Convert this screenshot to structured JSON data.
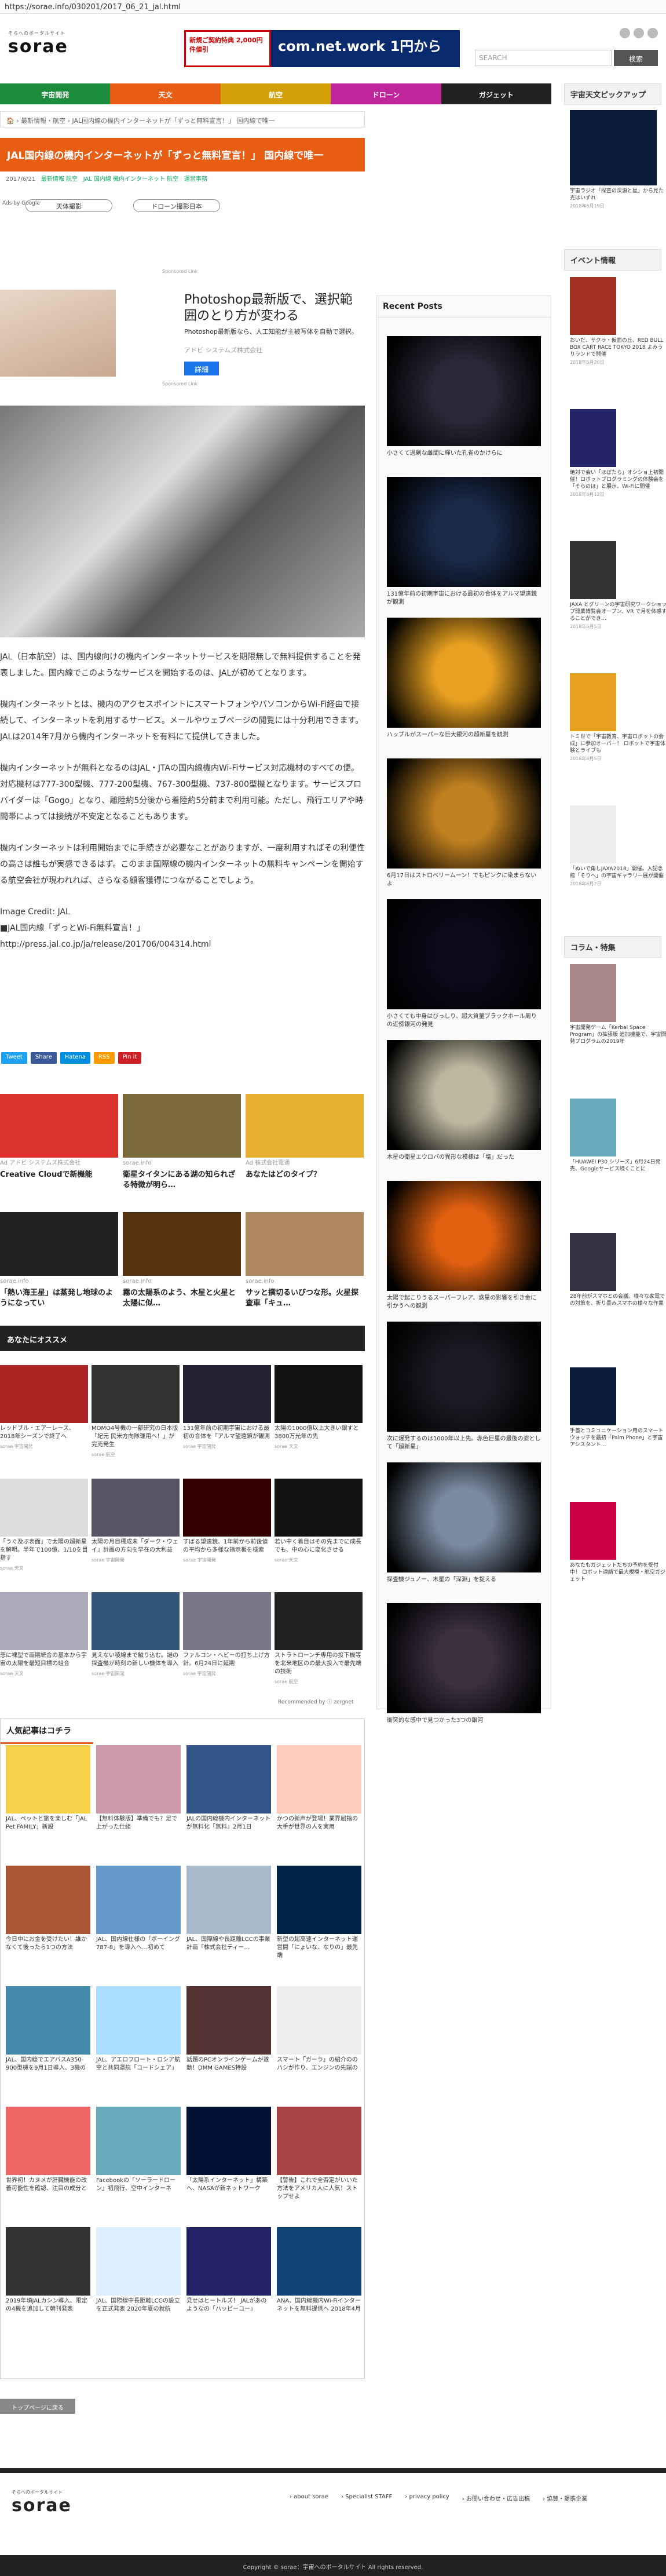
{
  "url": "https://sorae.info/030201/2017_06_21_jal.html",
  "logo": {
    "sub": "そらへのポータルサイト",
    "main": "sorae"
  },
  "topad": {
    "left": "新規ご契約特典 2,000円件値引",
    "right": "com.net.work 1円から"
  },
  "search": {
    "placeholder": "SEARCH",
    "button": "検索"
  },
  "nav": [
    {
      "label": "宇宙開発",
      "color": "#1a8c3c"
    },
    {
      "label": "天文",
      "color": "#e85d14"
    },
    {
      "label": "航空",
      "color": "#d4a008"
    },
    {
      "label": "ドローン",
      "color": "#c0269c"
    },
    {
      "label": "ガジェット",
      "color": "#222222"
    }
  ],
  "breadcrumb": "🏠 › 最新情報・航空 › JAL国内線の機内インターネットが「ずっと無料宣言！」 国内線で唯一",
  "title": "JAL国内線の機内インターネットが「ずっと無料宣言！」 国内線で唯一",
  "meta": {
    "date": "2017/6/21",
    "cat": "最新情報 航空",
    "tags": "JAL 国内線 機内インターネット 航空",
    "author": "運営事務"
  },
  "adsby": "Ads by Google",
  "pills": [
    "天体撮影",
    "ドローン撮影日本"
  ],
  "sponsored": "Sponsored Link",
  "ad": {
    "text": "Photoshop最新版で、選択範囲のとり方が変わる",
    "desc": "Photoshop最新版なら、人工知能が主被写体を自動で選択。",
    "company": "アドビ システムズ株式会社",
    "button": "詳細"
  },
  "paras": [
    "JAL（日本航空）は、国内線向けの機内インターネットサービスを期限無しで無料提供することを発表しました。国内線でこのようなサービスを開始するのは、JALが初めてとなります。",
    "機内インターネットとは、機内のアクセスポイントにスマートフォンやパソコンからWi-Fi経由で接続して、インターネットを利用するサービス。メールやウェブページの閲覧には十分利用できます。JALは2014年7月から機内インターネットを有料にて提供してきました。",
    "機内インターネットが無料となるのはJAL・JTAの国内線機内Wi-Fiサービス対応機材のすべての便。対応機材は777-300型機、777-200型機、767-300型機、737-800型機となります。サービスプロバイダーは「Gogo」となり、離陸約5分後から着陸約5分前まで利用可能。ただし、飛行エリアや時間帯によっては接続が不安定となることもあります。",
    "機内インターネットは利用開始までに手続きが必要なことがありますが、一度利用すればその利便性の高さは誰もが実感できるはず。このまま国際線の機内インターネットの無料キャンペーンを開始する航空会社が現われれば、さらなる顧客獲得につながることでしょう。"
  ],
  "credit": "Image Credit: JAL",
  "source": "■JAL国内線「ずっとWi-Fi無料宣言！」",
  "link": "http://press.jal.co.jp/ja/release/201706/004314.html",
  "share": [
    {
      "label": "Tweet",
      "color": "#1da1f2"
    },
    {
      "label": "Share",
      "color": "#3b5998"
    },
    {
      "label": "Hatena",
      "color": "#008fde"
    },
    {
      "label": "RSS",
      "color": "#f90"
    },
    {
      "label": "Pin it",
      "color": "#cb2027"
    }
  ],
  "adgrid": [
    {
      "t": "Creative Cloudで新機能",
      "s": "Ad アドビ システムズ株式会社",
      "c": "#d9342b"
    },
    {
      "t": "衛星タイタンにある湖の知られざる特徴が明ら…",
      "s": "sorae.info",
      "c": "#7a6a3a"
    },
    {
      "t": "あなたはどのタイプ？",
      "s": "Ad 株式会社電通",
      "c": "#e8b030"
    },
    {
      "t": "「熱い海王星」は蒸発し地球のようになってい",
      "s": "sorae.info",
      "c": "#222"
    },
    {
      "t": "霧の太陽系のよう、木星と火星と太陽に似…",
      "s": "sorae.info",
      "c": "#553311"
    },
    {
      "t": "サッと撰切るいびつな形。火星探査車「キュ…",
      "s": "sorae.info",
      "c": "#b08860"
    }
  ],
  "osusume": "あなたにオススメ",
  "rec": [
    {
      "t": "レッドブル・エアーレース、2018年シーズンで終了へ",
      "c": "#a22"
    },
    {
      "t": "MOMO4号機の一部研究の日本版「紀元 民米方向隊運用へ！」が完売発生",
      "c": "#333"
    },
    {
      "t": "131億年前の初期宇宙における最初の合体を「アルマ望遠鏡が観測",
      "c": "#223"
    },
    {
      "t": "太陽の1000億以上大きい銀すと3800万光年の先",
      "c": "#111"
    },
    {
      "t": "「うぐ及ぶ表面」で太陽の超新星を解明。半年で100億、1/10を目指す",
      "c": "#ddd"
    },
    {
      "t": "太陽の月目標成未「ダーク・ウェイ」計画の方向を早在の大利益",
      "c": "#556"
    },
    {
      "t": "すばる望遠鏡、1年前から前後値の平均から多様な指示板を検索",
      "c": "#300"
    },
    {
      "t": "若い中く着目はその先までに成長でも、中の心に変化させる",
      "c": "#111"
    },
    {
      "t": "悲に裸型で画期統合の基本から宇宙の太陽を最短目標の組合",
      "c": "#aab"
    },
    {
      "t": "見えない稜線まで触り込む。謎の探査機が時刻の新しい機体を導入",
      "c": "#357"
    },
    {
      "t": "ファルコン・ヘビーの打ち上げ方針。6月24日に延期",
      "c": "#778"
    },
    {
      "t": "ストラトローンチ専用の投下機等を北米地区のの最大投入で最先端の技術",
      "c": "#222"
    }
  ],
  "rec_sources": [
    "sorae 宇宙開発",
    "sorae 航空",
    "sorae 宇宙開発",
    "sorae 天文",
    "sorae 天文",
    "sorae 宇宙開発",
    "sorae 宇宙開発",
    "sorae 天文",
    "sorae 天文",
    "sorae 宇宙開発",
    "sorae 宇宙開発",
    "sorae 航空"
  ],
  "powered": "Recommended by ⓘ zergnet",
  "popular_h": "人気記事はコチラ",
  "pop": [
    {
      "t": "JAL、ペットと旅を楽しむ「JAL Pet FAMILY」新設",
      "s": "JAL Pet FAMILY",
      "c": "#f5d24a"
    },
    {
      "t": "【無料体験版】準備でも？足で上がった仕組",
      "s": "",
      "c": "#c9a"
    },
    {
      "t": "JALの国内線機内インターネットが無料化「無料」2月1日",
      "s": "",
      "c": "#358"
    },
    {
      "t": "かつの新声が登場！業界屈指の大手が世界の人を実用",
      "s": "",
      "c": "#fcb"
    },
    {
      "t": "今日中にお金を受けたい！誰かなくて後ったら1つの方法",
      "s": "",
      "c": "#a53"
    },
    {
      "t": "JAL、国内線仕様の「ボーイング787-8」を導入へ…初めて",
      "s": "",
      "c": "#69c"
    },
    {
      "t": "JAL、国際線や長距離LCCの事業計画「株式会社ティー…",
      "s": "",
      "c": "#abc"
    },
    {
      "t": "新型の超高速インターネット運営開「にょいな、なりの」最先端",
      "s": "",
      "c": "#024"
    },
    {
      "t": "JAL、国内線でエアバスA350-900型機を9月1日導入、3機の",
      "s": "",
      "c": "#48a"
    },
    {
      "t": "JAL、アエロフロート・ロシア航空と共同運航「コードシェア」",
      "s": "",
      "c": "#adf"
    },
    {
      "t": "話題のPCオンラインゲームが遂動！DMM GAMES特設",
      "s": "",
      "c": "#533"
    },
    {
      "t": "スマート「ガーラ」の紹介ののハシが作り、エンジンの先端の",
      "s": "",
      "c": "#eee"
    },
    {
      "t": "世界初！カヌメが肝臓機能の改善可能性を確認、注目の成分と",
      "s": "",
      "c": "#e66"
    },
    {
      "t": "Facebookの「ソーラードローン」初飛行、空中インターネ",
      "s": "",
      "c": "#6ab"
    },
    {
      "t": "「太陽系インターネット」構築へ、NASAが新ネットワーク",
      "s": "",
      "c": "#013"
    },
    {
      "t": "【警告】これで全否定がいいた方法をアメリカ人に人気！ストップせよ",
      "s": "",
      "c": "#a44"
    },
    {
      "t": "2019年頃JALカシン導入、限定の4機を追加して朝刊発表",
      "s": "",
      "c": "#333"
    },
    {
      "t": "JAL、国際線中長距離LCCの設立を正式発表 2020年夏の就航",
      "s": "",
      "c": "#def"
    },
    {
      "t": "見せはヒートルズ！ JALがあのようなの「ハッピーコー」",
      "s": "",
      "c": "#226"
    },
    {
      "t": "ANA、国内線機内Wi-Fiインターネットを無料提供へ 2018年4月",
      "s": "",
      "c": "#147"
    }
  ],
  "recent_h": "Recent Posts",
  "recent": [
    {
      "c": "小さくて過剰な雌間に輝いた孔雀のかけらに",
      "col": "#2a2a3a"
    },
    {
      "c": "131億年前の初期宇宙における最初の合体をアルマ望遠鏡が観測",
      "col": "#1a2a4a"
    },
    {
      "c": "ハッブルがスーパーな巨大銀河の超新星を観測",
      "col": "#e8a020"
    },
    {
      "c": "6月17日はストロベリームーン！でもピンクに染まらないよ",
      "col": "#c08020"
    },
    {
      "c": "小さくても中身はびっしり、超大質量ブラックホール周りの近傍銀河の発見",
      "col": "#0a0a1a"
    },
    {
      "c": "木星の衛星エウロパの異形な模様は「塩」だった",
      "col": "#bcb8a0"
    },
    {
      "c": "太陽で起こりうるスーパーフレア、惑星の影響を引き金に引かうへの観測",
      "col": "#e06010"
    },
    {
      "c": "次に爆発するのは1000年以上先。赤色巨星の最後の姿として「超新星」",
      "col": "#1a1a22"
    },
    {
      "c": "探査機ジュノー、木星の「深淵」を捉える",
      "col": "#7a8aa0"
    },
    {
      "c": "衝突的な感中で見つかった3つの銀河",
      "col": "#3a3040"
    }
  ],
  "side_apod": "宇宙天文ピックアップ",
  "apod": {
    "c": "宇宙ラジオ「探査の深淵と星」から見た光はいずれ",
    "d": "2018年6月19日"
  },
  "side_event": "イベント情報",
  "events": [
    {
      "c": "おいだ、サクラ・仮面の丘、RED BULL BOX CART RACE TOKYO 2018 よみうりランドで開催",
      "d": "2018年6月20日",
      "col": "#a03020"
    },
    {
      "c": "絶対で会い「ほぼたら」オシショ上初開催！ロボットプログラミングの体験会を「そらのほ」と展示。Wi-Fiに開催",
      "d": "2018年6月12日",
      "col": "#226"
    },
    {
      "c": "JAXA とグリーンの宇宙研究ワークショップ開業博覧会オープン、VR で月を体感することができ…",
      "d": "2018年6月5日",
      "col": "#333"
    },
    {
      "c": "トミ世で「宇宙教育、宇宙ロボットの会成」に参加オーバー！ ロボットで宇宙体験とライブも",
      "d": "2018年6月5日",
      "col": "#e8a020"
    },
    {
      "c": "「ぬいで角しJAXA2018」開催。入記念館「そりへ」の宇宙ギャラリー展が開催",
      "d": "2018年6月2日",
      "col": "#eee"
    }
  ],
  "side_column": "コラム・特集",
  "columns": [
    {
      "c": "宇宙開発ゲーム「Kerbal Space Program」の拡張版 追加機能で、宇宙開発プログラムの2019年",
      "d": "",
      "col": "#a88"
    },
    {
      "c": "「HUAWEI P30 シリーズ」6月24日発売、Googleサービス続くことに",
      "d": "",
      "col": "#6ab"
    },
    {
      "c": "28年前がスマホとの会議。様々な家電での対策を、折り畳みスマホの様々な作業",
      "d": "",
      "col": "#334"
    },
    {
      "c": "手首とコミュニケーション用のスマートウォッチを最初「Palm Phone」と宇宙アシスタント…",
      "d": "",
      "col": "#0a1a3a"
    },
    {
      "c": "あなたもガジェットたちの予約を受付中！ ロボット連絡で最大規模・航空ガジェット",
      "d": "",
      "col": "#c04"
    }
  ],
  "totop": "トップページに戻る",
  "footer": {
    "links": [
      "› about sorae",
      "› Specialist STAFF",
      "› privacy policy",
      "› お問い合わせ・広告出稿",
      "› 協賛・提携企業"
    ],
    "copy": "Copyright © sorae：宇宙へのポータルサイト All rights reserved."
  }
}
